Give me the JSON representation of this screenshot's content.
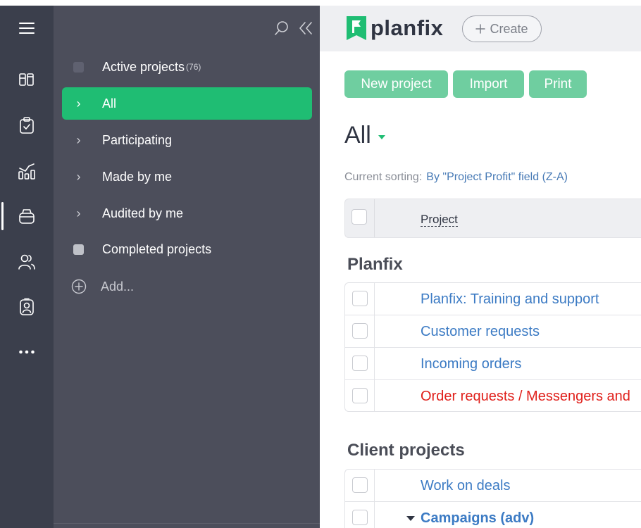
{
  "nav": {
    "items": [
      {
        "name": "menu-icon"
      },
      {
        "name": "board-icon"
      },
      {
        "name": "tasks-icon"
      },
      {
        "name": "analytics-icon"
      },
      {
        "name": "projects-icon",
        "active": true
      },
      {
        "name": "contacts-icon"
      },
      {
        "name": "employees-icon"
      },
      {
        "name": "more-icon"
      }
    ]
  },
  "sidebar": {
    "items": [
      {
        "label": "Active projects",
        "count": "(76)",
        "lead": "square"
      },
      {
        "label": "All",
        "lead": "chevron",
        "active": true
      },
      {
        "label": "Participating",
        "lead": "chevron"
      },
      {
        "label": "Made by me",
        "lead": "chevron"
      },
      {
        "label": "Audited by me",
        "lead": "chevron"
      },
      {
        "label": "Completed projects",
        "lead": "square-light"
      }
    ],
    "add_label": "Add..."
  },
  "header": {
    "logo_text": "planfix",
    "create_label": "Create"
  },
  "toolbar": {
    "new_project": "New project",
    "import": "Import",
    "print": "Print"
  },
  "view": {
    "title": "All",
    "sorting_label": "Current sorting:",
    "sorting_value": "By \"Project Profit\" field (Z-A)"
  },
  "table": {
    "column_project": "Project",
    "groups": [
      {
        "title": "Planfix",
        "rows": [
          {
            "name": "Planfix: Training and support",
            "color": "blue"
          },
          {
            "name": "Customer requests",
            "color": "blue"
          },
          {
            "name": "Incoming orders",
            "color": "blue"
          },
          {
            "name": "Order requests / Messengers and",
            "color": "red"
          }
        ]
      },
      {
        "title": "Client projects",
        "rows": [
          {
            "name": "Work on deals",
            "color": "blue"
          },
          {
            "name": "Campaigns (adv)",
            "color": "blue",
            "bold": true,
            "expanded": true
          }
        ]
      }
    ]
  },
  "colors": {
    "accent": "#1fbd73",
    "button": "#6fcea0",
    "link": "#3c7bc4",
    "danger": "#e0201b",
    "rail": "#3b3f4c",
    "panel": "#4c4e5b"
  }
}
